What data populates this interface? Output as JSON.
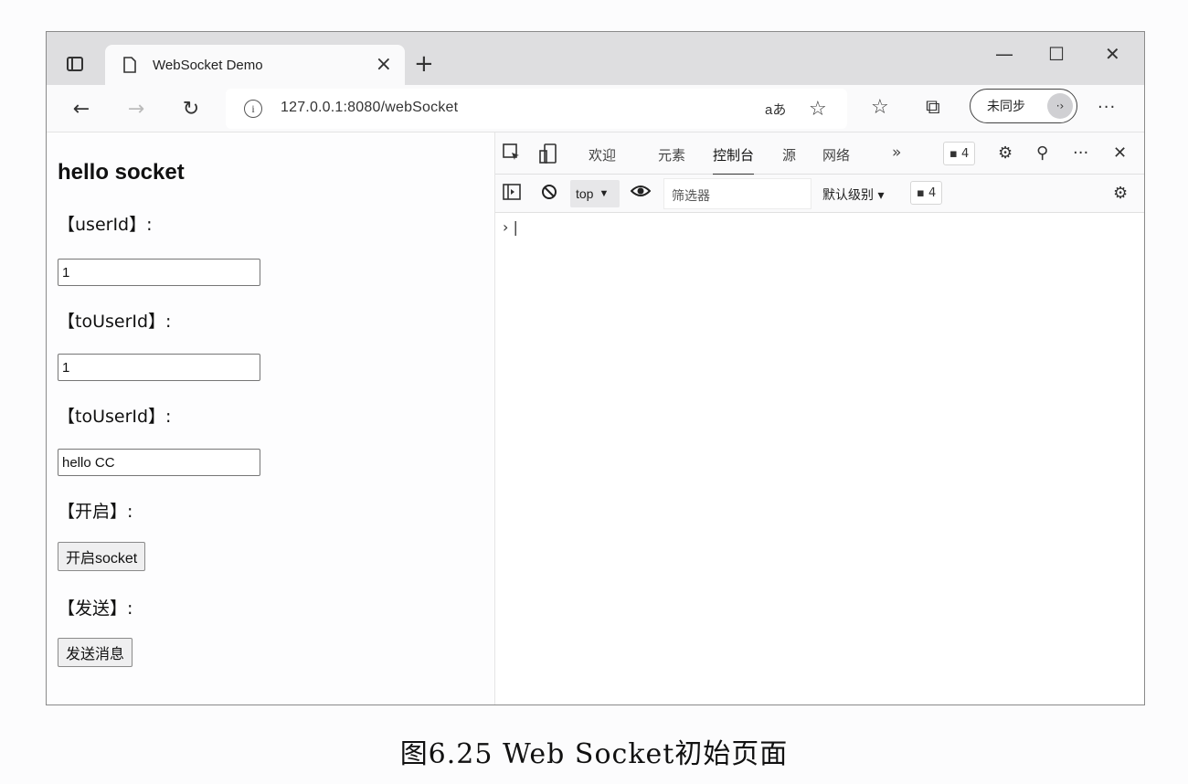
{
  "browser": {
    "tab_title": "WebSocket Demo",
    "tab_close": "×",
    "new_tab": "+",
    "minimize": "—",
    "maximize": "☐",
    "close": "✕",
    "url": "127.0.0.1:8080/webSocket",
    "read_aloud": "aあ",
    "sync_label": "未同步",
    "more": "···"
  },
  "page": {
    "heading": "hello socket",
    "userId_label": "【userId】:",
    "userId_value": "1",
    "toUserId_label": "【toUserId】:",
    "toUserId_value": "1",
    "message_label": "【toUserId】:",
    "message_value": "hello CC",
    "open_label": "【开启】:",
    "open_button": "开启socket",
    "send_label": "【发送】:",
    "send_button": "发送消息"
  },
  "devtools": {
    "tabs": [
      {
        "label": "欢迎",
        "active": false
      },
      {
        "label": "元素",
        "active": false
      },
      {
        "label": "控制台",
        "active": true
      },
      {
        "label": "源",
        "active": false
      },
      {
        "label": "网络",
        "active": false
      }
    ],
    "more_tabs": "»",
    "issues_count": "4",
    "context": "top",
    "filter_placeholder": "筛选器",
    "level": "默认级别 ▾",
    "messages_count": "4",
    "prompt": "› |"
  },
  "caption": "图6.25  Web Socket初始页面"
}
